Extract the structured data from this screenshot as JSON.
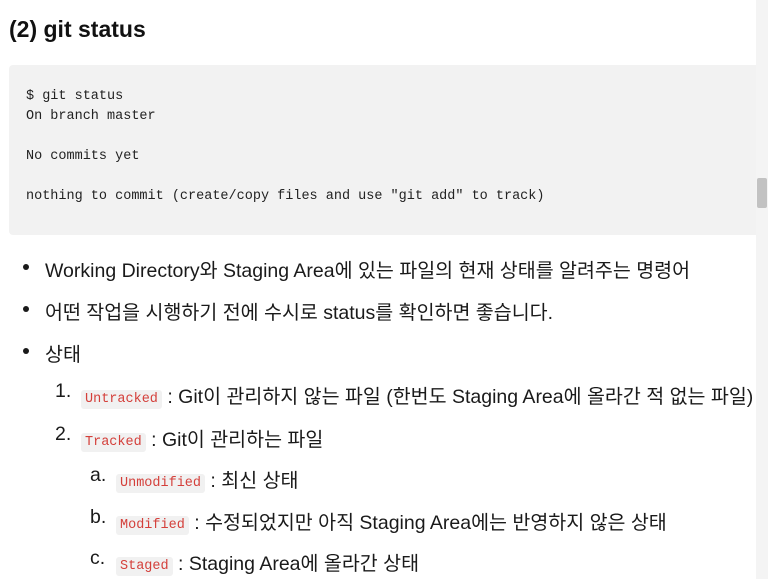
{
  "heading": "(2) git status",
  "code_lines": [
    "$ git status",
    "On branch master",
    "",
    "No commits yet",
    "",
    "nothing to commit (create/copy files and use \"git add\" to track)"
  ],
  "bullets": [
    "Working Directory와 Staging Area에 있는 파일의 현재 상태를 알려주는 명령어",
    "어떤 작업을 시행하기 전에 수시로 status를 확인하면 좋습니다.",
    "상태"
  ],
  "states": [
    {
      "marker": "1.",
      "code": "Untracked",
      "text": " : Git이 관리하지 않는 파일 (한번도 Staging Area에 올라간 적 없는 파일)"
    },
    {
      "marker": "2.",
      "code": "Tracked",
      "text": " : Git이 관리하는 파일"
    }
  ],
  "tracked_substates": [
    {
      "marker": "a.",
      "code": "Unmodified",
      "text": " : 최신 상태"
    },
    {
      "marker": "b.",
      "code": "Modified",
      "text": " : 수정되었지만 아직 Staging Area에는 반영하지 않은 상태"
    },
    {
      "marker": "c.",
      "code": "Staged",
      "text": " : Staging Area에 올라간 상태"
    }
  ]
}
